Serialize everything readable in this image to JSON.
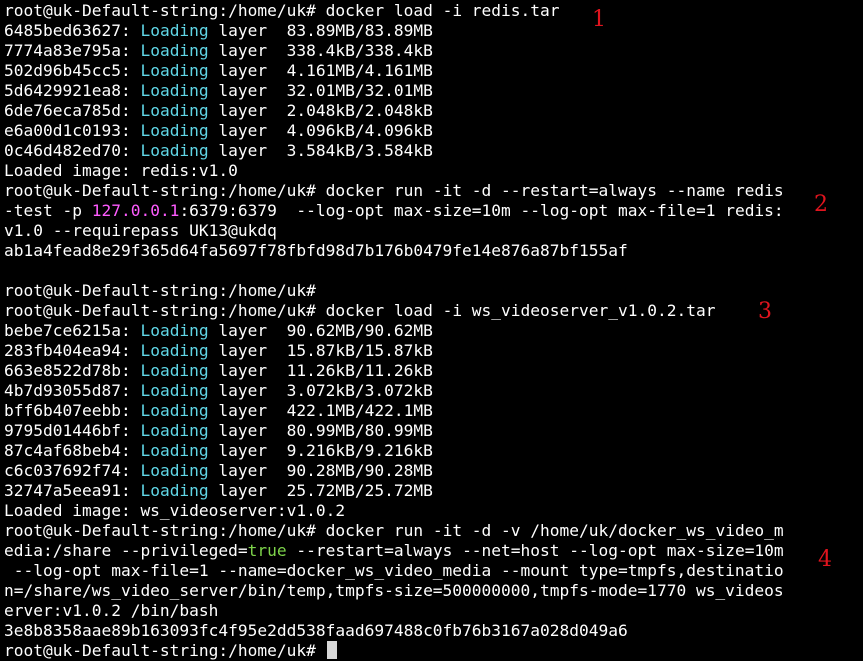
{
  "colors": {
    "background": "#000000",
    "text": "#ffffff",
    "loading": "#60d6e6",
    "ip": "#ff5cff",
    "bool": "#7dd34a",
    "annotation": "#e0141e"
  },
  "prompt": "root@uk-Default-string:/home/uk#",
  "loading_word": "Loading",
  "cmd1": {
    "command": " docker load -i redis.tar",
    "layers": [
      {
        "id": "6485bed63627:",
        "progress": " layer  83.89MB/83.89MB"
      },
      {
        "id": "7774a83e795a:",
        "progress": " layer  338.4kB/338.4kB"
      },
      {
        "id": "502d96b45cc5:",
        "progress": " layer  4.161MB/4.161MB"
      },
      {
        "id": "5d6429921ea8:",
        "progress": " layer  32.01MB/32.01MB"
      },
      {
        "id": "6de76eca785d:",
        "progress": " layer  2.048kB/2.048kB"
      },
      {
        "id": "e6a00d1c0193:",
        "progress": " layer  4.096kB/4.096kB"
      },
      {
        "id": "0c46d482ed70:",
        "progress": " layer  3.584kB/3.584kB"
      }
    ],
    "loaded": "Loaded image: redis:v1.0"
  },
  "cmd2": {
    "line1": " docker run -it -d --restart=always --name redis",
    "line2_a": "-test -p ",
    "ip": "127.0.0.1",
    "line2_b": ":6379:6379  --log-opt max-size=10m --log-opt max-file=1 redis:",
    "line3": "v1.0 --requirepass UK13@ukdq",
    "output": "ab1a4fead8e29f365d64fa5697f78fbfd98d7b176b0479fe14e876a87bf155af"
  },
  "cmd3": {
    "command": " docker load -i ws_videoserver_v1.0.2.tar",
    "layers": [
      {
        "id": "bebe7ce6215a:",
        "progress": " layer  90.62MB/90.62MB"
      },
      {
        "id": "283fb404ea94:",
        "progress": " layer  15.87kB/15.87kB"
      },
      {
        "id": "663e8522d78b:",
        "progress": " layer  11.26kB/11.26kB"
      },
      {
        "id": "4b7d93055d87:",
        "progress": " layer  3.072kB/3.072kB"
      },
      {
        "id": "bff6b407eebb:",
        "progress": " layer  422.1MB/422.1MB"
      },
      {
        "id": "9795d01446bf:",
        "progress": " layer  80.99MB/80.99MB"
      },
      {
        "id": "87c4af68beb4:",
        "progress": " layer  9.216kB/9.216kB"
      },
      {
        "id": "c6c037692f74:",
        "progress": " layer  90.28MB/90.28MB"
      },
      {
        "id": "32747a5eea91:",
        "progress": " layer  25.72MB/25.72MB"
      }
    ],
    "loaded": "Loaded image: ws_videoserver:v1.0.2"
  },
  "cmd4": {
    "line1": " docker run -it -d -v /home/uk/docker_ws_video_m",
    "line2_a": "edia:/share --privileged=",
    "bool": "true",
    "line2_b": " --restart=always --net=host --log-opt max-size=10m",
    "line3": " --log-opt max-file=1 --name=docker_ws_video_media --mount type=tmpfs,destinatio",
    "line4": "n=/share/ws_video_server/bin/temp,tmpfs-size=500000000,tmpfs-mode=1770 ws_videos",
    "line5": "erver:v1.0.2 /bin/bash",
    "output": "3e8b8358aae89b163093fc4f95e2dd538faad697488c0fb76b3167a028d049a6"
  },
  "annotations": [
    "1",
    "2",
    "3",
    "4"
  ]
}
